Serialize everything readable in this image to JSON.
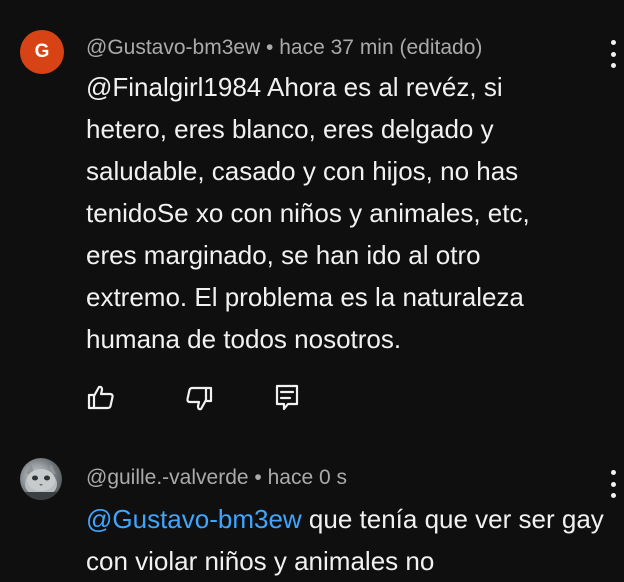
{
  "comments": [
    {
      "avatar_letter": "G",
      "avatar_color": "#d84315",
      "author": "@Gustavo-bm3ew",
      "separator": " • ",
      "time": "hace 37 min (editado)",
      "mention": "@Finalgirl1984",
      "text": "  Ahora es al revéz, si hetero, eres blanco, eres delgado y saludable, casado y con hijos, no has tenidoSe xo con niños y animales, etc, eres marginado, se han ido al otro extremo. El problema es la naturaleza humana de todos nosotros."
    },
    {
      "avatar_icon": "cat-photo-avatar",
      "author": "@guille.-valverde",
      "separator": " • ",
      "time": "hace 0 s",
      "mention": " @Gustavo-bm3ew",
      "text": " que tenía que ver ser gay con violar niños y animales no"
    }
  ],
  "icons": {
    "like": "thumbs-up-icon",
    "dislike": "thumbs-down-icon",
    "reply": "reply-icon",
    "menu": "more-vertical-icon"
  },
  "colors": {
    "background": "#0f0f0f",
    "text": "#f1f1f1",
    "meta": "#aaaaaa",
    "mention": "#3ea6ff"
  }
}
